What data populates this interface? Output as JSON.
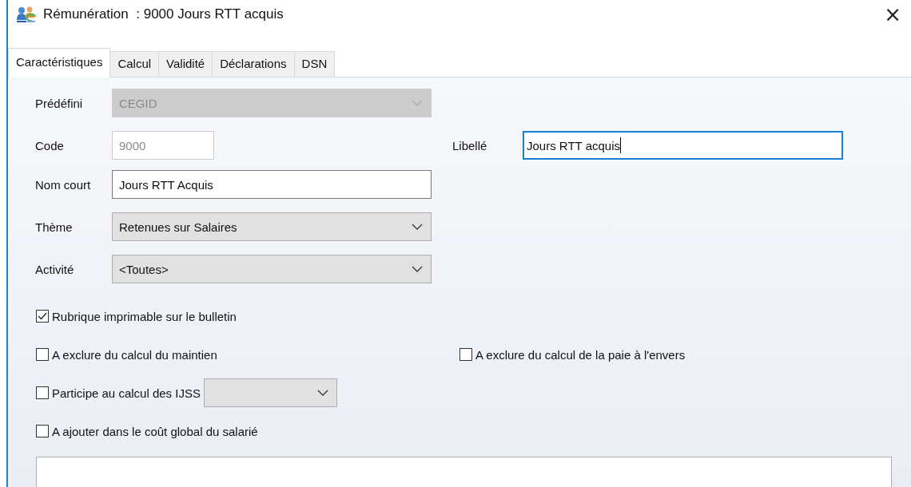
{
  "window": {
    "title": "Rémunération  : 9000 Jours RTT acquis",
    "close": "×"
  },
  "tabs": [
    {
      "label": "Caractéristiques",
      "selected": true
    },
    {
      "label": "Calcul",
      "selected": false
    },
    {
      "label": "Validité",
      "selected": false
    },
    {
      "label": "Déclarations",
      "selected": false
    },
    {
      "label": "DSN",
      "selected": false
    }
  ],
  "form_rows": [
    {
      "fields": [
        {
          "kind": "combo",
          "label": "Prédéfini",
          "value": "CEGID",
          "disabled": true,
          "focused": false
        }
      ]
    },
    {
      "fields": [
        {
          "kind": "text",
          "label": "Code",
          "value": "9000",
          "disabled": true,
          "focused": false,
          "short": true
        },
        {
          "kind": "text",
          "label": "Libellé",
          "value": "Jours RTT acquis",
          "disabled": false,
          "focused": true
        }
      ]
    },
    {
      "fields": [
        {
          "kind": "text",
          "label": "Nom court",
          "value": "Jours RTT Acquis",
          "disabled": false,
          "focused": false
        }
      ]
    },
    {
      "fields": [
        {
          "kind": "combo",
          "label": "Thème",
          "value": "Retenues sur Salaires",
          "disabled": false,
          "focused": false
        }
      ]
    },
    {
      "fields": [
        {
          "kind": "combo",
          "label": "Activité",
          "value": "<Toutes>",
          "disabled": false,
          "focused": false
        }
      ]
    }
  ],
  "option_rows": [
    {
      "options": [
        {
          "kind": "checkbox",
          "label": "Rubrique imprimable sur le bulletin",
          "checked": true
        }
      ]
    },
    {
      "options": [
        {
          "kind": "checkbox",
          "label": "A exclure du calcul du maintien",
          "checked": false
        },
        {
          "kind": "checkbox",
          "label": "A exclure du calcul de la paie à l'envers",
          "checked": false
        }
      ]
    },
    {
      "options": [
        {
          "kind": "checkbox_combo",
          "label": "Participe au calcul des IJSS",
          "checked": false
        }
      ]
    },
    {
      "options": [
        {
          "kind": "checkbox",
          "label": "A ajouter dans le coût global du salarié",
          "checked": false
        }
      ]
    }
  ]
}
